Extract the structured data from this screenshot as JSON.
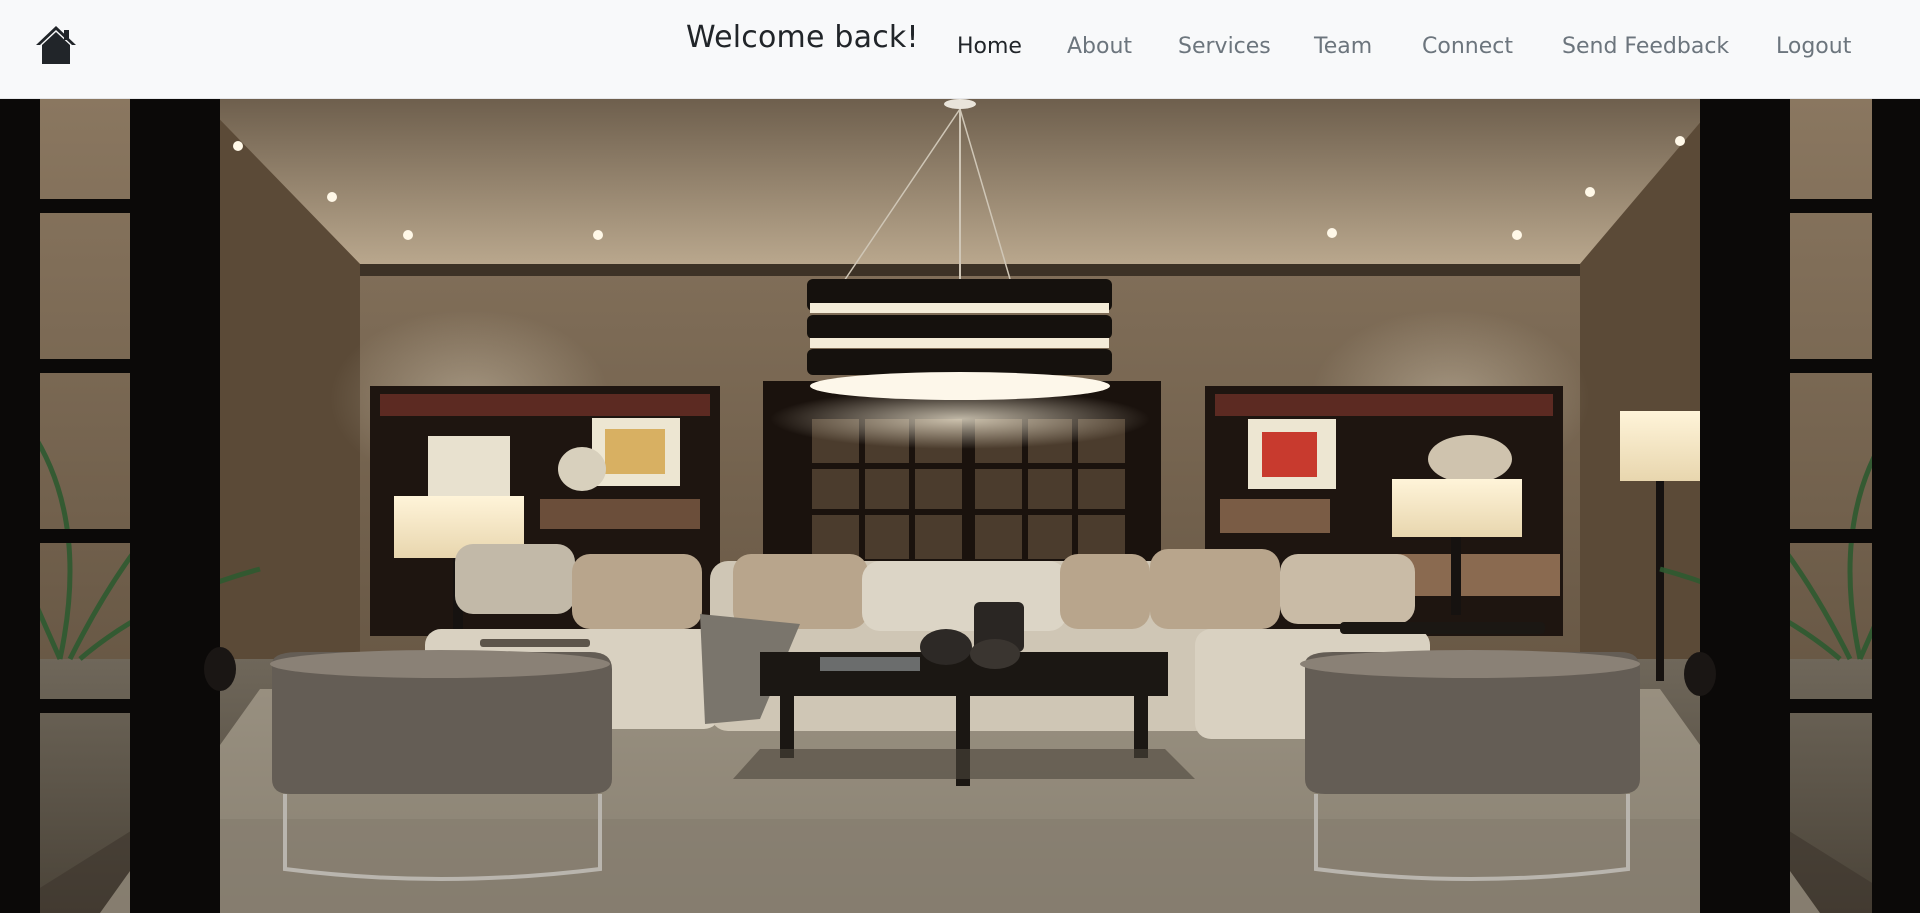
{
  "page_title": "Welcome back!",
  "brand": {
    "icon": "home-icon"
  },
  "nav": {
    "items": [
      {
        "label": "Home",
        "active": true
      },
      {
        "label": "About",
        "active": false
      },
      {
        "label": "Services",
        "active": false
      },
      {
        "label": "Team",
        "active": false
      },
      {
        "label": "Connect",
        "active": false
      },
      {
        "label": "Send Feedback",
        "active": false
      },
      {
        "label": "Logout",
        "active": false
      }
    ]
  },
  "hero": {
    "subject": "living-room-photo"
  },
  "colors": {
    "navbar_bg": "#f8f9fa",
    "nav_active": "#212529",
    "nav_inactive": "#6c757d"
  }
}
